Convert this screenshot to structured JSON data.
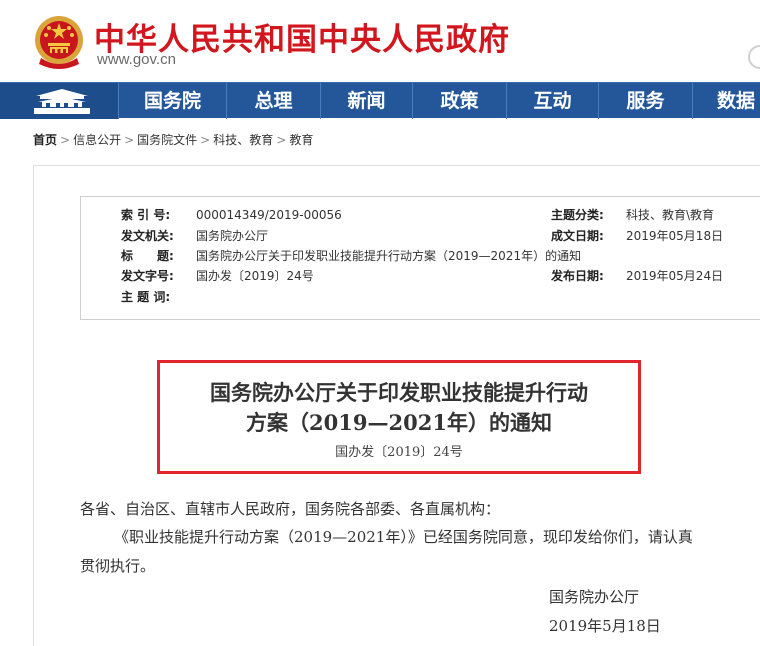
{
  "header": {
    "site_title": "中华人民共和国中央人民政府",
    "site_url": "www.gov.cn"
  },
  "nav": {
    "items": [
      "国务院",
      "总理",
      "新闻",
      "政策",
      "互动",
      "服务",
      "数据"
    ]
  },
  "breadcrumb": {
    "items": [
      "首页",
      "信息公开",
      "国务院文件",
      "科技、教育",
      "教育"
    ]
  },
  "meta": {
    "index_label": "索 引 号:",
    "index_value": "000014349/2019-00056",
    "category_label": "主题分类:",
    "category_value": "科技、教育\\教育",
    "issuer_label": "发文机关:",
    "issuer_value": "国务院办公厅",
    "created_label": "成文日期:",
    "created_value": "2019年05月18日",
    "title_label": "标　　题:",
    "title_value": "国务院办公厅关于印发职业技能提升行动方案（2019—2021年）的通知",
    "docno_label": "发文字号:",
    "docno_value": "国办发〔2019〕24号",
    "published_label": "发布日期:",
    "published_value": "2019年05月24日",
    "subject_label": "主 题 词:",
    "subject_value": ""
  },
  "document": {
    "title_line1": "国务院办公厅关于印发职业技能提升行动",
    "title_line2": "方案（2019—2021年）的通知",
    "number": "国办发〔2019〕24号",
    "salutation": "各省、自治区、直辖市人民政府，国务院各部委、各直属机构：",
    "para1_line1": "《职业技能提升行动方案（2019—2021年）》已经国务院同意，现印发给你们，请认真",
    "para1_line2": "贯彻执行。",
    "signature": "国务院办公厅",
    "date": "2019年5月18日"
  },
  "colors": {
    "brand_red": "#d2161d",
    "nav_blue": "#23579a",
    "highlight_red": "#e0252b"
  }
}
